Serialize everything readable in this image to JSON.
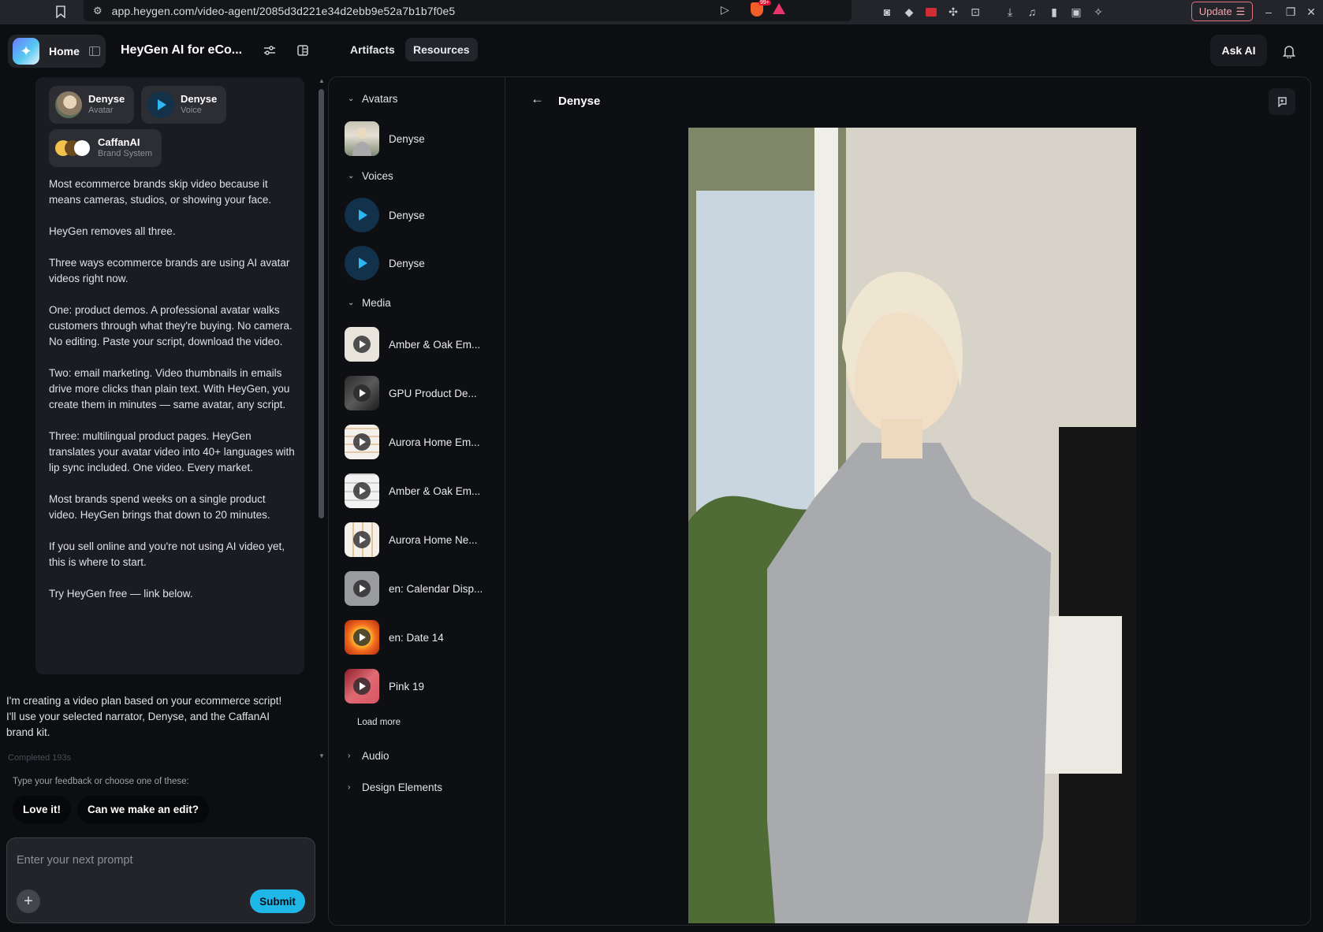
{
  "browser": {
    "url": "app.heygen.com/video-agent/2085d3d221e34d2ebb9e52a7b1b7f0e5",
    "update_label": "Update",
    "badge": "99+"
  },
  "header": {
    "home_label": "Home",
    "project_title": "HeyGen AI for eCo...",
    "tabs": [
      {
        "label": "Artifacts"
      },
      {
        "label": "Resources"
      }
    ],
    "ask_ai_label": "Ask AI"
  },
  "chat": {
    "chips": [
      {
        "title": "Denyse",
        "subtitle": "Avatar"
      },
      {
        "title": "Denyse",
        "subtitle": "Voice"
      },
      {
        "title": "CaffanAI",
        "subtitle": "Brand System"
      }
    ],
    "brand_colors": [
      "#f2c14e",
      "#6b4a1e",
      "#ffffff"
    ],
    "message_paragraphs": [
      "Most ecommerce brands skip video because it means cameras, studios, or showing your face.",
      "HeyGen removes all three.",
      "Three ways ecommerce brands are using AI avatar videos right now.",
      "One: product demos. A professional avatar walks customers through what they're buying. No camera. No editing. Paste your script, download the video.",
      "Two: email marketing. Video thumbnails in emails drive more clicks than plain text. With HeyGen, you create them in minutes — same avatar, any script.",
      "Three: multilingual product pages. HeyGen translates your avatar video into 40+ languages with lip sync included. One video. Every market.",
      "Most brands spend weeks on a single product video. HeyGen brings that down to 20 minutes.",
      "If you sell online and you're not using AI video yet, this is where to start.",
      "Try HeyGen free — link below."
    ],
    "assistant_message": "I'm creating a video plan based on your ecommerce script! I'll use your selected narrator, Denyse, and the CaffanAI brand kit.",
    "faded_status": "Completed 193s",
    "feedback_prompt": "Type your feedback or choose one of these:",
    "quick_replies": [
      "Love it!",
      "Can we make an edit?"
    ],
    "input_placeholder": "Enter your next prompt",
    "submit_label": "Submit"
  },
  "resources": {
    "sections": {
      "avatars": "Avatars",
      "voices": "Voices",
      "media": "Media",
      "audio": "Audio",
      "design": "Design Elements"
    },
    "avatars": [
      {
        "label": "Denyse"
      }
    ],
    "voices": [
      {
        "label": "Denyse"
      },
      {
        "label": "Denyse"
      }
    ],
    "media": [
      {
        "label": "Amber & Oak Em..."
      },
      {
        "label": "GPU Product De..."
      },
      {
        "label": "Aurora Home Em..."
      },
      {
        "label": "Amber & Oak Em..."
      },
      {
        "label": "Aurora Home Ne..."
      },
      {
        "label": "en: Calendar Disp..."
      },
      {
        "label": "en: Date 14"
      },
      {
        "label": "Pink 19"
      }
    ],
    "load_more_label": "Load more",
    "detail_title": "Denyse"
  }
}
